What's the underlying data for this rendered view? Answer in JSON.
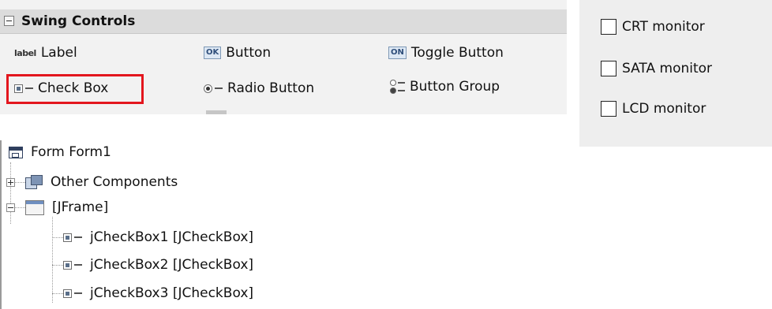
{
  "palette": {
    "title": "Swing Controls",
    "items": [
      {
        "label": "Label",
        "icon": "label-icon",
        "icon_text": "label"
      },
      {
        "label": "Button",
        "icon": "button-icon",
        "icon_text": "OK"
      },
      {
        "label": "Toggle Button",
        "icon": "toggle-button-icon",
        "icon_text": "ON"
      },
      {
        "label": "Check Box",
        "icon": "checkbox-icon"
      },
      {
        "label": "Radio Button",
        "icon": "radio-button-icon"
      },
      {
        "label": "Button Group",
        "icon": "button-group-icon"
      }
    ],
    "highlight_color": "#e3161e"
  },
  "preview": {
    "checkboxes": [
      {
        "label": "CRT monitor",
        "checked": false
      },
      {
        "label": "SATA monitor",
        "checked": false
      },
      {
        "label": "LCD monitor",
        "checked": false
      }
    ]
  },
  "navigator": {
    "root": "Form Form1",
    "nodes": [
      {
        "label": "Other Components",
        "expanded": false
      },
      {
        "label": "[JFrame]",
        "expanded": true
      }
    ],
    "children": [
      {
        "label": "jCheckBox1 [JCheckBox]"
      },
      {
        "label": "jCheckBox2 [JCheckBox]"
      },
      {
        "label": "jCheckBox3 [JCheckBox]"
      }
    ]
  }
}
